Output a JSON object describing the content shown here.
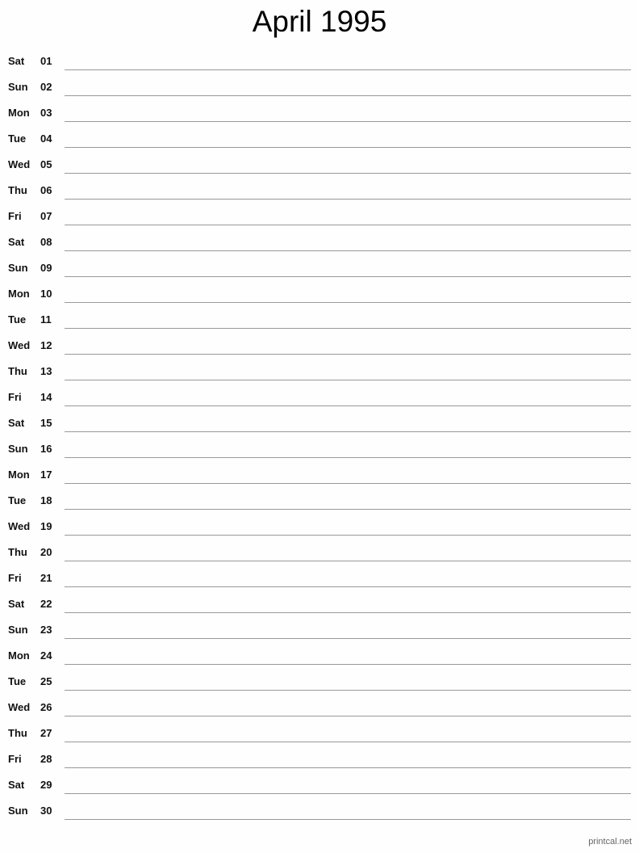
{
  "title": "April 1995",
  "days": [
    {
      "day": "Sat",
      "num": "01"
    },
    {
      "day": "Sun",
      "num": "02"
    },
    {
      "day": "Mon",
      "num": "03"
    },
    {
      "day": "Tue",
      "num": "04"
    },
    {
      "day": "Wed",
      "num": "05"
    },
    {
      "day": "Thu",
      "num": "06"
    },
    {
      "day": "Fri",
      "num": "07"
    },
    {
      "day": "Sat",
      "num": "08"
    },
    {
      "day": "Sun",
      "num": "09"
    },
    {
      "day": "Mon",
      "num": "10"
    },
    {
      "day": "Tue",
      "num": "11"
    },
    {
      "day": "Wed",
      "num": "12"
    },
    {
      "day": "Thu",
      "num": "13"
    },
    {
      "day": "Fri",
      "num": "14"
    },
    {
      "day": "Sat",
      "num": "15"
    },
    {
      "day": "Sun",
      "num": "16"
    },
    {
      "day": "Mon",
      "num": "17"
    },
    {
      "day": "Tue",
      "num": "18"
    },
    {
      "day": "Wed",
      "num": "19"
    },
    {
      "day": "Thu",
      "num": "20"
    },
    {
      "day": "Fri",
      "num": "21"
    },
    {
      "day": "Sat",
      "num": "22"
    },
    {
      "day": "Sun",
      "num": "23"
    },
    {
      "day": "Mon",
      "num": "24"
    },
    {
      "day": "Tue",
      "num": "25"
    },
    {
      "day": "Wed",
      "num": "26"
    },
    {
      "day": "Thu",
      "num": "27"
    },
    {
      "day": "Fri",
      "num": "28"
    },
    {
      "day": "Sat",
      "num": "29"
    },
    {
      "day": "Sun",
      "num": "30"
    }
  ],
  "footer": "printcal.net"
}
